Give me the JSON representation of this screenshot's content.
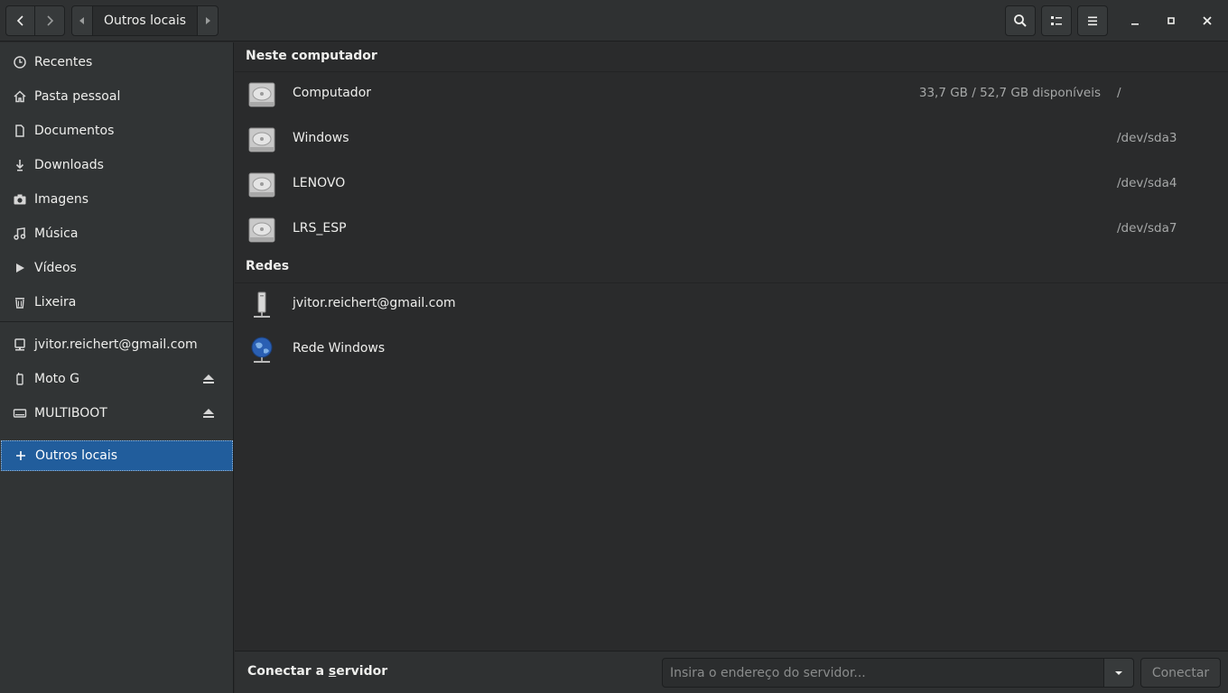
{
  "header": {
    "path_label": "Outros locais"
  },
  "sidebar": {
    "items": [
      {
        "label": "Recentes",
        "icon": "clock-icon"
      },
      {
        "label": "Pasta pessoal",
        "icon": "home-icon"
      },
      {
        "label": "Documentos",
        "icon": "document-icon"
      },
      {
        "label": "Downloads",
        "icon": "download-icon"
      },
      {
        "label": "Imagens",
        "icon": "camera-icon"
      },
      {
        "label": "Música",
        "icon": "music-icon"
      },
      {
        "label": "Vídeos",
        "icon": "video-icon"
      },
      {
        "label": "Lixeira",
        "icon": "trash-icon"
      }
    ],
    "devices": [
      {
        "label": "jvitor.reichert@gmail.com",
        "icon": "network-account-icon"
      },
      {
        "label": "Moto G",
        "icon": "phone-icon",
        "eject": true
      },
      {
        "label": "MULTIBOOT",
        "icon": "drive-icon",
        "eject": true
      }
    ],
    "other_locations": {
      "label": "Outros locais",
      "icon": "plus-icon"
    }
  },
  "main": {
    "sections": [
      {
        "title": "Neste computador",
        "rows": [
          {
            "name": "Computador",
            "free": "33,7 GB / 52,7 GB disponíveis",
            "path": "/",
            "icon": "harddisk-icon"
          },
          {
            "name": "Windows",
            "free": "",
            "path": "/dev/sda3",
            "icon": "harddisk-icon"
          },
          {
            "name": "LENOVO",
            "free": "",
            "path": "/dev/sda4",
            "icon": "harddisk-icon"
          },
          {
            "name": "LRS_ESP",
            "free": "",
            "path": "/dev/sda7",
            "icon": "harddisk-icon"
          }
        ]
      },
      {
        "title": "Redes",
        "rows": [
          {
            "name": "jvitor.reichert@gmail.com",
            "free": "",
            "path": "",
            "icon": "network-server-icon"
          },
          {
            "name": "Rede Windows",
            "free": "",
            "path": "",
            "icon": "network-globe-icon"
          }
        ]
      }
    ]
  },
  "bottom": {
    "connect_label_pre": "Conectar a ",
    "connect_label_mnemonic": "s",
    "connect_label_post": "ervidor",
    "server_placeholder": "Insira o endereço do servidor...",
    "connect_button": "Conectar"
  },
  "colors": {
    "accent": "#215d9c",
    "background": "#2a2b2c",
    "sidebar": "#313435",
    "headerbar": "#2f3132"
  }
}
